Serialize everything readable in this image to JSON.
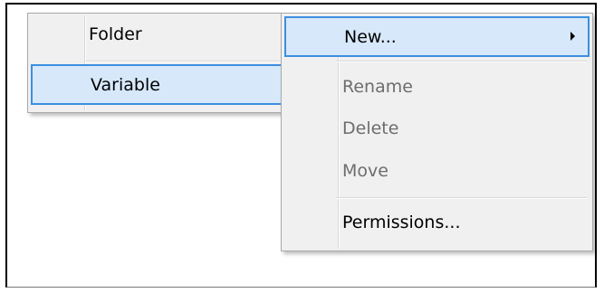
{
  "left_menu": {
    "items": [
      {
        "label": "Folder",
        "disabled": false
      },
      {
        "label": "Variable",
        "disabled": false,
        "highlighted": true
      }
    ]
  },
  "right_menu": {
    "items": [
      {
        "label": "New...",
        "disabled": false,
        "highlighted": true,
        "has_submenu": true
      },
      {
        "label": "Rename",
        "disabled": true
      },
      {
        "label": "Delete",
        "disabled": true
      },
      {
        "label": "Move",
        "disabled": true
      },
      {
        "label": "Permissions...",
        "disabled": false
      }
    ]
  },
  "icons": {
    "submenu_arrow": "chevron-right-icon"
  },
  "colors": {
    "menu_background": "#f0f0f0",
    "highlight_background": "#d7e8fa",
    "highlight_border": "#3c8fe0",
    "disabled_text": "#6d6d6d"
  }
}
